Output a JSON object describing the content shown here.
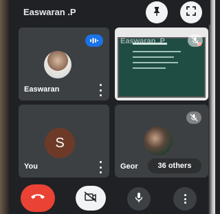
{
  "meeting": {
    "title": "Easwaran .P"
  },
  "header": {
    "pin_icon": "pin-icon",
    "fullscreen_icon": "fullscreen-icon"
  },
  "tiles": [
    {
      "name": "Easwaran",
      "speaking": true,
      "icon": "speaking-indicator-icon"
    },
    {
      "name": "Easwaran .P",
      "presenting": true,
      "icon": "mic-off-icon"
    },
    {
      "name": "You",
      "initial": "S",
      "avatar_color": "#6d3a27"
    },
    {
      "name": "Geor",
      "others_label": "36 others",
      "icon": "mic-off-icon"
    }
  ],
  "controls": {
    "end_call_icon": "phone-hangup-icon",
    "camera_icon": "camera-off-icon",
    "mic_icon": "mic-icon",
    "more_icon": "more-vert-icon"
  },
  "colors": {
    "background": "#202124",
    "tile": "#3c4043",
    "end_call": "#ea4335",
    "speaking": "#1a73e8",
    "slide_bg": "#1f4d44"
  }
}
